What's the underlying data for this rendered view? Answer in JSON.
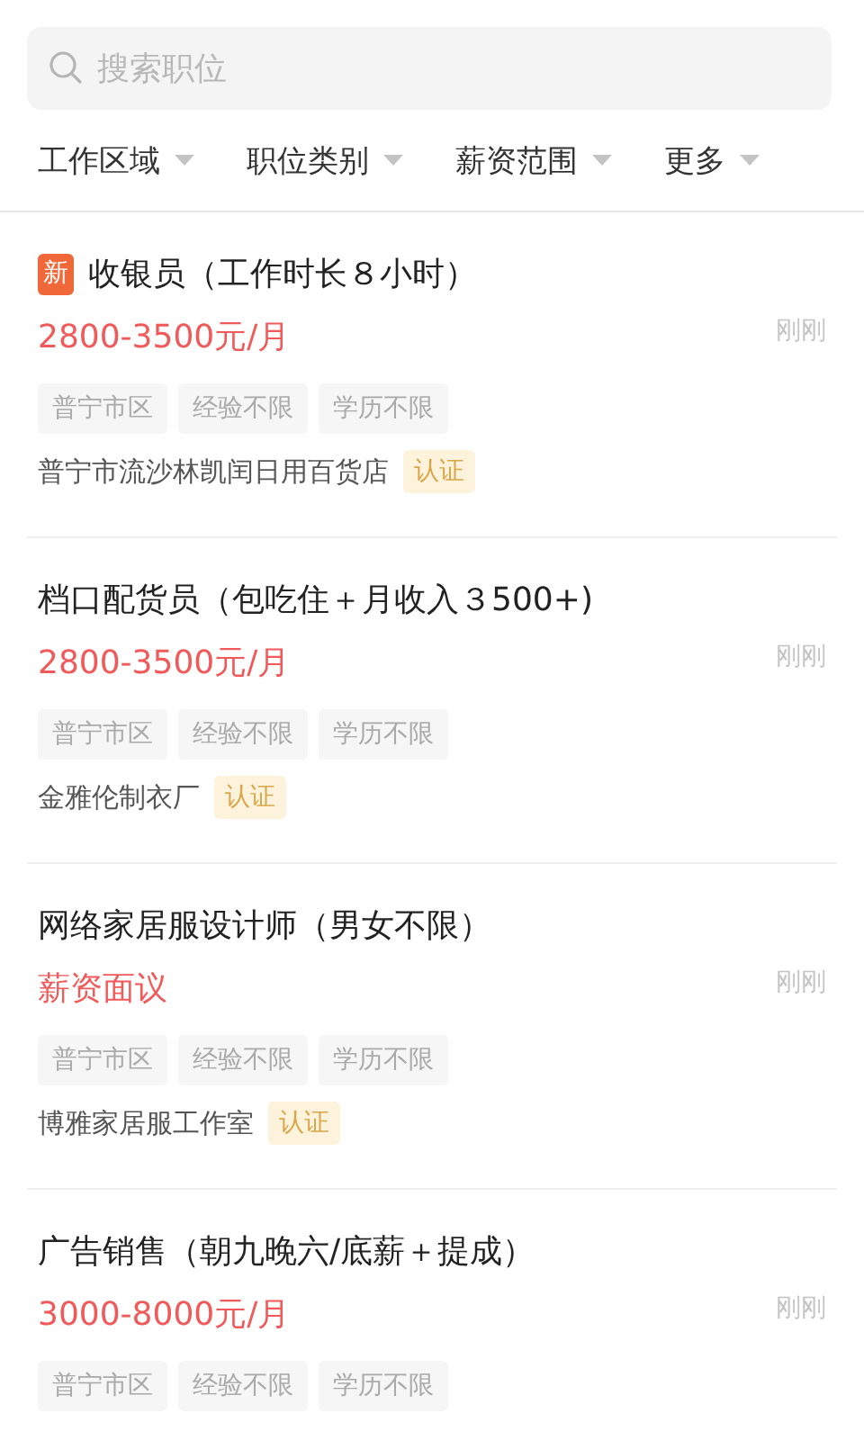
{
  "search": {
    "placeholder": "搜索职位"
  },
  "filters": [
    {
      "label": "工作区域"
    },
    {
      "label": "职位类别"
    },
    {
      "label": "薪资范围"
    },
    {
      "label": "更多"
    }
  ],
  "jobs": [
    {
      "title": "收银员（工作时长８小时）",
      "new": true,
      "new_label": "新",
      "salary": "2800-3500元/月",
      "time": "刚刚",
      "tags": [
        "普宁市区",
        "经验不限",
        "学历不限"
      ],
      "company": "普宁市流沙林凯闰日用百货店",
      "verified": true,
      "verified_label": "认证"
    },
    {
      "title": "档口配货员（包吃住＋月收入３500+)",
      "new": false,
      "salary": "2800-3500元/月",
      "time": "刚刚",
      "tags": [
        "普宁市区",
        "经验不限",
        "学历不限"
      ],
      "company": "金雅伦制衣厂",
      "verified": true,
      "verified_label": "认证"
    },
    {
      "title": "网络家居服设计师（男女不限）",
      "new": false,
      "salary": "薪资面议",
      "time": "刚刚",
      "tags": [
        "普宁市区",
        "经验不限",
        "学历不限"
      ],
      "company": "博雅家居服工作室",
      "verified": true,
      "verified_label": "认证"
    },
    {
      "title": "广告销售（朝九晚六/底薪＋提成）",
      "new": false,
      "salary": "3000-8000元/月",
      "time": "刚刚",
      "tags": [
        "普宁市区",
        "经验不限",
        "学历不限"
      ]
    }
  ]
}
